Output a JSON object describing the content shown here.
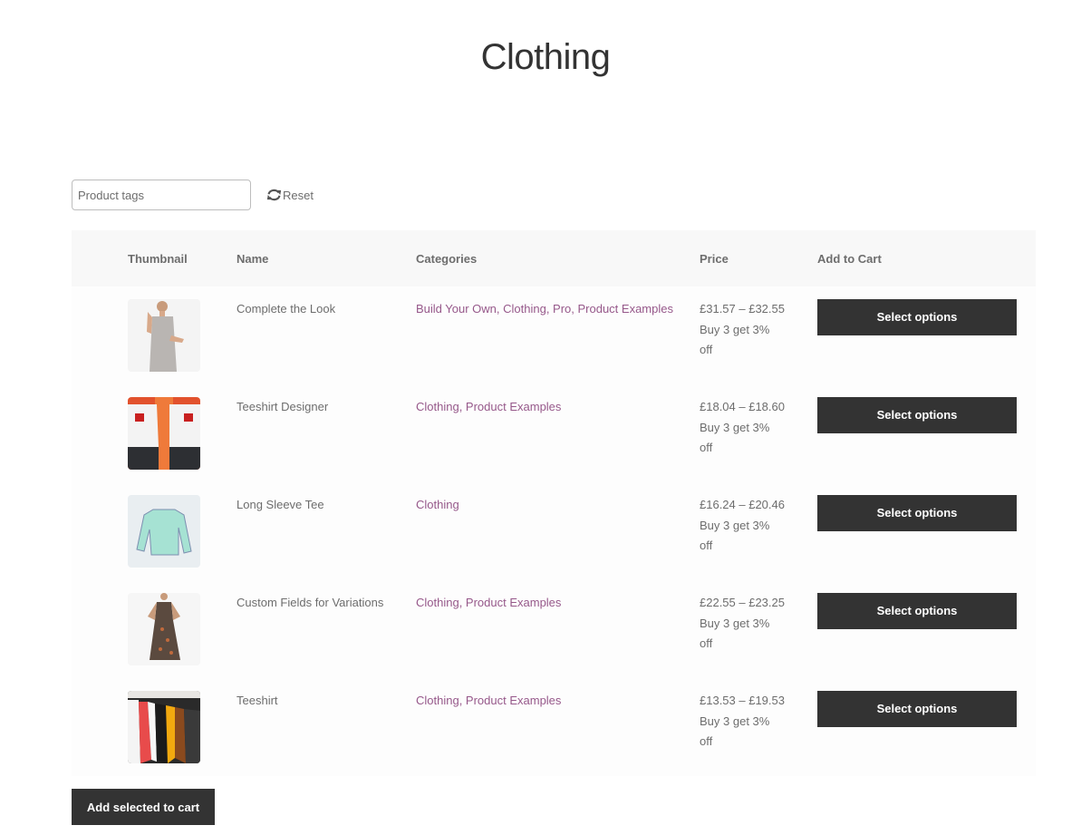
{
  "page": {
    "title": "Clothing"
  },
  "filters": {
    "tag_placeholder": "Product tags",
    "tag_value": "",
    "reset_label": "Reset",
    "reset_icon": "refresh-icon"
  },
  "table": {
    "headers": [
      "",
      "Thumbnail",
      "Name",
      "Categories",
      "Price",
      "Add to Cart"
    ],
    "rows": [
      {
        "name": "Complete the Look",
        "categories": "Build Your Own, Clothing, Pro, Product Examples",
        "price": "£31.57 – £32.55",
        "offer": "Buy 3 get 3% off",
        "button": "Select options",
        "thumbnail": "woman-grey-top"
      },
      {
        "name": "Teeshirt Designer",
        "categories": "Clothing, Product Examples",
        "price": "£18.04 – £18.60",
        "offer": "Buy 3 get 3% off",
        "button": "Select options",
        "thumbnail": "two-men-white-tees"
      },
      {
        "name": "Long Sleeve Tee",
        "categories": "Clothing",
        "price": "£16.24 – £20.46",
        "offer": "Buy 3 get 3% off",
        "button": "Select options",
        "thumbnail": "mint-long-sleeve"
      },
      {
        "name": "Custom Fields for Variations",
        "categories": "Clothing, Product Examples",
        "price": "£22.55 – £23.25",
        "offer": "Buy 3 get 3% off",
        "button": "Select options",
        "thumbnail": "floral-dress"
      },
      {
        "name": "Teeshirt",
        "categories": "Clothing, Product Examples",
        "price": "£13.53 – £19.53",
        "offer": "Buy 3 get 3% off",
        "button": "Select options",
        "thumbnail": "shirts-on-rack"
      }
    ]
  },
  "footer": {
    "add_selected_label": "Add selected to cart"
  },
  "colors": {
    "accent_link": "#96588a",
    "button_bg": "#333333",
    "header_bg": "#f8f8f8"
  }
}
